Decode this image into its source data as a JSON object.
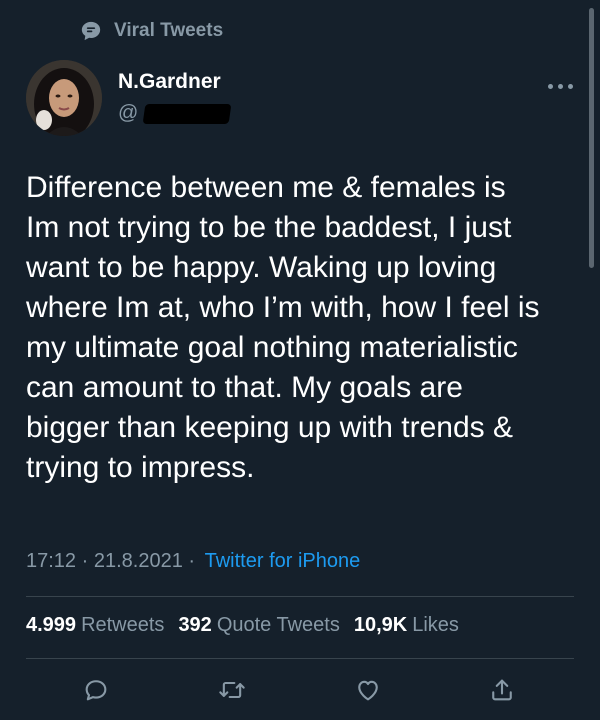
{
  "context": {
    "label": "Viral Tweets",
    "icon": "speech-bubble-icon"
  },
  "author": {
    "name": "N.Gardner",
    "handle_prefix": "@"
  },
  "tweet": {
    "text": "Difference between me & females is\nIm not trying to be the baddest, I just\nwant to be happy. Waking up loving\nwhere Im at, who I’m with, how I feel is\nmy ultimate goal nothing materialistic\ncan amount to that. My goals are\nbigger than keeping up with trends &\ntrying to impress."
  },
  "meta": {
    "time": "17:12",
    "separator": " · ",
    "date": "21.8.2021",
    "separator2": " · ",
    "source": "Twitter for iPhone"
  },
  "stats": {
    "retweets_count": "4.999",
    "retweets_label": "Retweets",
    "quotes_count": "392",
    "quotes_label": "Quote Tweets",
    "likes_count": "10,9K",
    "likes_label": "Likes"
  },
  "actions": [
    "reply-icon",
    "retweet-icon",
    "like-icon",
    "share-icon"
  ],
  "colors": {
    "background": "#15202b",
    "muted": "#8899a6",
    "accent": "#1d9bf0",
    "divider": "#38444d"
  }
}
